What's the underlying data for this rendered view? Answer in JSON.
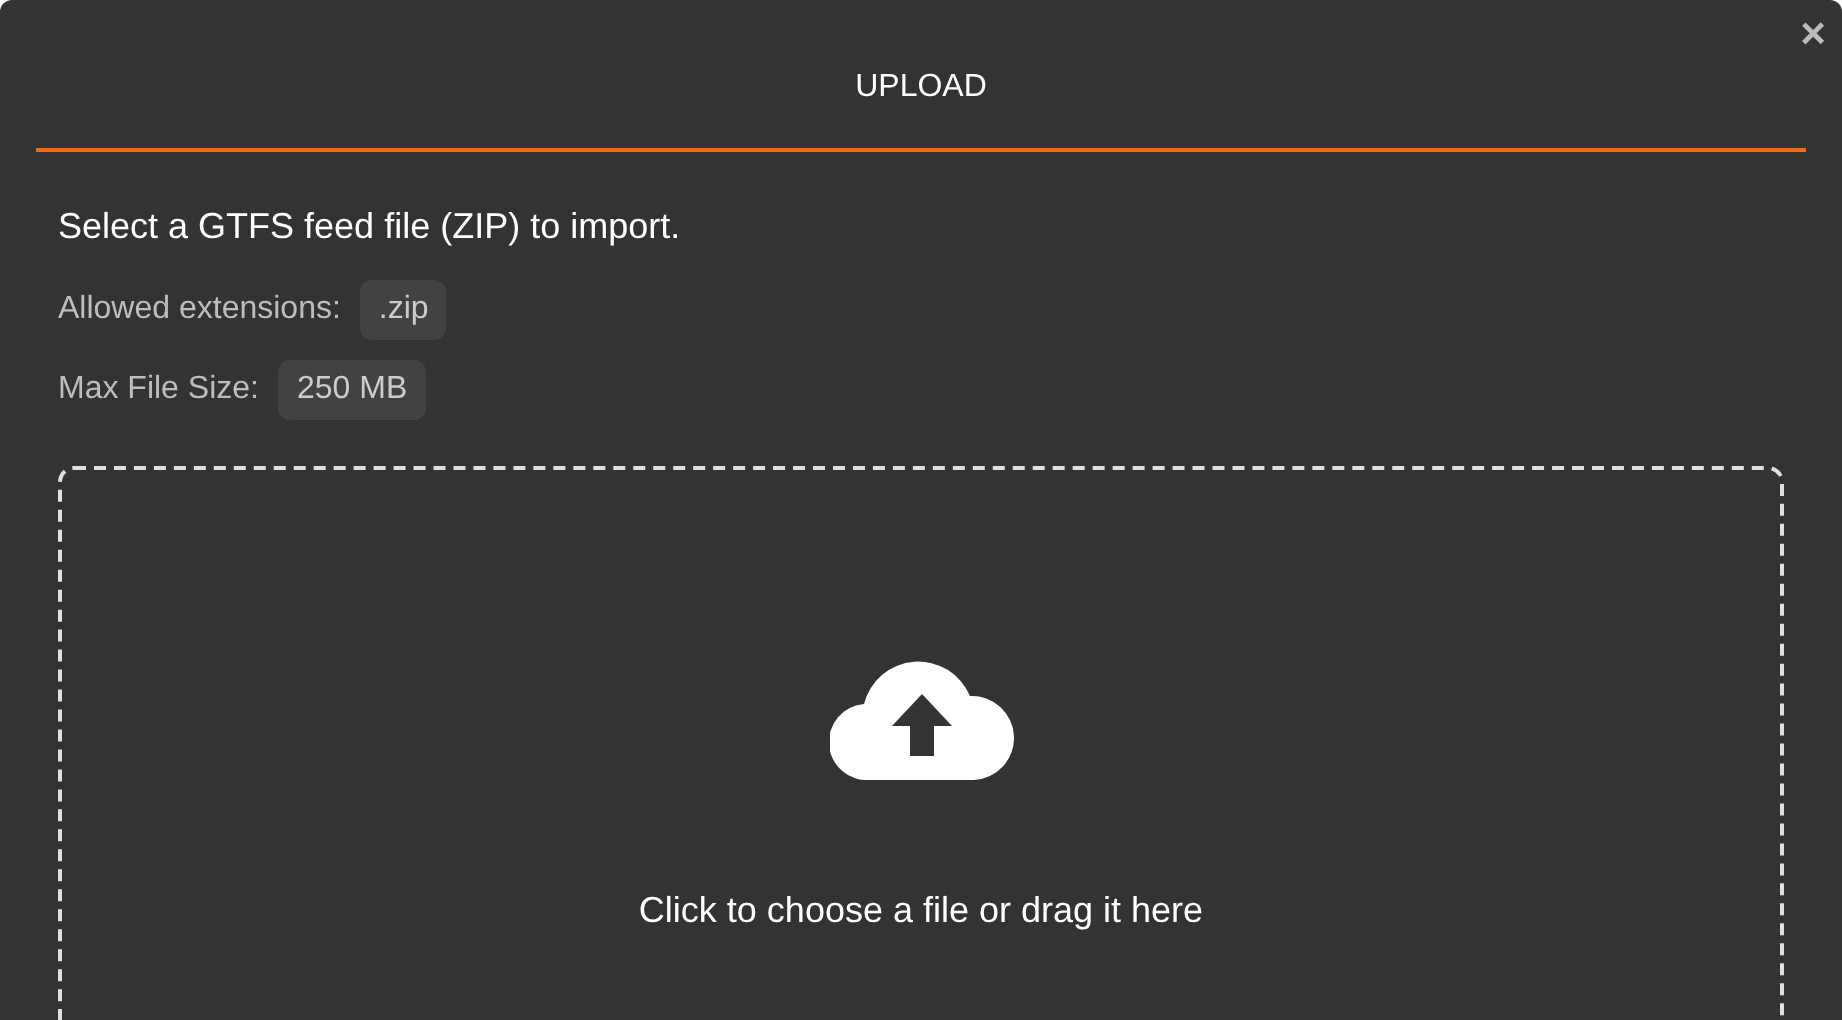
{
  "dialog": {
    "title": "UPLOAD",
    "close": "×"
  },
  "intro": "Select a GTFS feed file (ZIP) to import.",
  "info_rows": [
    {
      "label": "Allowed extensions:",
      "value": ".zip"
    },
    {
      "label": "Max File Size:",
      "value": "250 MB"
    }
  ],
  "drop_zone": {
    "text": "Click to choose a file or drag it here"
  }
}
